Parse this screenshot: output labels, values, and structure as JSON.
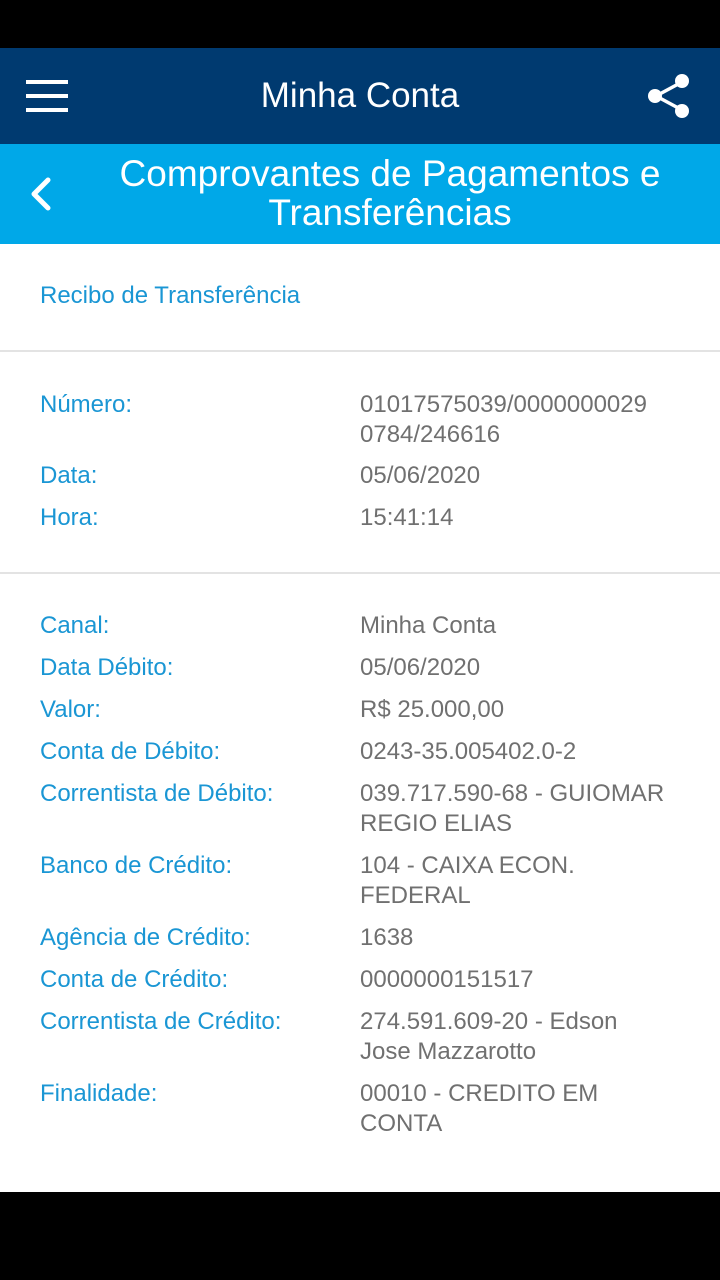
{
  "header": {
    "title": "Minha Conta"
  },
  "subheader": {
    "title": "Comprovantes de Pagamentos e Transferências"
  },
  "receipt": {
    "title": "Recibo de Transferência",
    "section1": [
      {
        "key": "Número:",
        "value": "01017575039/0000000029\n0784/246616"
      },
      {
        "key": "Data:",
        "value": "05/06/2020"
      },
      {
        "key": "Hora:",
        "value": "15:41:14"
      }
    ],
    "section2": [
      {
        "key": "Canal:",
        "value": "Minha Conta"
      },
      {
        "key": "Data Débito:",
        "value": "05/06/2020"
      },
      {
        "key": "Valor:",
        "value": "R$ 25.000,00"
      },
      {
        "key": "Conta de Débito:",
        "value": "0243-35.005402.0-2"
      },
      {
        "key": "Correntista de Débito:",
        "value": "039.717.590-68 - GUIOMAR\nREGIO ELIAS"
      },
      {
        "key": "Banco de Crédito:",
        "value": "104 - CAIXA ECON.\nFEDERAL"
      },
      {
        "key": "Agência de Crédito:",
        "value": "1638"
      },
      {
        "key": "Conta de Crédito:",
        "value": "0000000151517"
      },
      {
        "key": "Correntista de Crédito:",
        "value": "274.591.609-20 - Edson\nJose Mazzarotto"
      },
      {
        "key": "Finalidade:",
        "value": "00010 - CREDITO EM\nCONTA"
      }
    ]
  }
}
